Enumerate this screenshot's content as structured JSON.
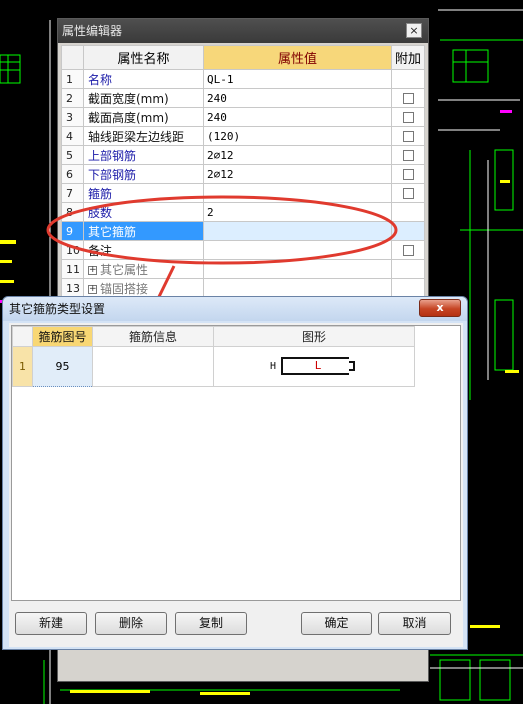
{
  "property_editor": {
    "title": "属性编辑器",
    "close_glyph": "×",
    "headers": {
      "name": "属性名称",
      "value": "属性值",
      "extra": "附加"
    },
    "rows": [
      {
        "no": "1",
        "name": "名称",
        "value": "QL-1",
        "style": "blue",
        "checkbox": false
      },
      {
        "no": "2",
        "name": "截面宽度(mm)",
        "value": "240",
        "style": "black",
        "checkbox": true
      },
      {
        "no": "3",
        "name": "截面高度(mm)",
        "value": "240",
        "style": "black",
        "checkbox": true
      },
      {
        "no": "4",
        "name": "轴线距梁左边线距",
        "value": "(120)",
        "style": "black",
        "checkbox": true
      },
      {
        "no": "5",
        "name": "上部钢筋",
        "value": "2⌀12",
        "style": "blue",
        "checkbox": true
      },
      {
        "no": "6",
        "name": "下部钢筋",
        "value": "2⌀12",
        "style": "blue",
        "checkbox": true
      },
      {
        "no": "7",
        "name": "箍筋",
        "value": "",
        "style": "blue",
        "checkbox": true
      },
      {
        "no": "8",
        "name": "肢数",
        "value": "2",
        "style": "blue",
        "checkbox": false
      },
      {
        "no": "9",
        "name": "其它箍筋",
        "value": "",
        "style": "black",
        "checkbox": false,
        "selected": true
      },
      {
        "no": "10",
        "name": "备注",
        "value": "",
        "style": "black",
        "checkbox": true
      },
      {
        "no": "11",
        "name": "其它属性",
        "value": "",
        "style": "gray",
        "checkbox": false,
        "expander": "+"
      },
      {
        "no": "13",
        "name": "锚固搭接",
        "value": "",
        "style": "gray",
        "checkbox": false,
        "expander": "+"
      }
    ]
  },
  "dialog": {
    "title": "其它箍筋类型设置",
    "close_glyph": "x",
    "columns": {
      "figure_no": "箍筋图号",
      "info": "箍筋信息",
      "shape": "图形"
    },
    "rows": [
      {
        "row_no": "1",
        "figure_no": "95",
        "info": "",
        "shape_h": "H",
        "shape_l": "L"
      }
    ],
    "buttons": {
      "new": "新建",
      "delete": "删除",
      "copy": "复制",
      "ok": "确定",
      "cancel": "取消"
    }
  },
  "colors": {
    "annotation": "#e03a2e",
    "selected_row": "#3399ff",
    "header_highlight": "#f7d77a"
  }
}
